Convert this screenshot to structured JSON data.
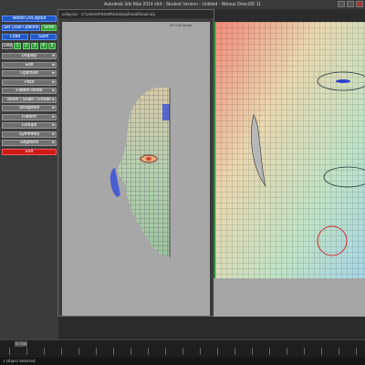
{
  "window": {
    "title": "Autodesk 3ds Max 2014 x64 - Student Version - Untitled - Nitrous Direct3D 11"
  },
  "left_panel": {
    "header": "About UVLayout",
    "top_buttons": {
      "set_load_options": "Set Load Options",
      "send": "Send",
      "load": "Load",
      "save": "Save"
    },
    "step_label": "Step",
    "step_numbers": [
      "1",
      "2",
      "3",
      "4",
      "5"
    ],
    "menu_items": [
      "Display",
      "Edit",
      "Optimize",
      "Pack",
      "Flatten Mode",
      "Move / Scale / Rotate",
      "Straighten",
      "Pattern",
      "Groups",
      "Symmetry",
      "Segment"
    ],
    "exit_label": "Exit",
    "colors": {
      "blue": "#1f58c8",
      "green": "#2e9e3a",
      "red": "#d01818",
      "gray": "#6f6f6f"
    }
  },
  "viewport_window": {
    "path": "uvlayout - C:\\Users\\PRO99\\Desktop\\head\\head.obj",
    "label": "3D Edit Mode"
  },
  "timeline": {
    "frame_label": "0 / 100",
    "ruler": [
      "0",
      "5",
      "10",
      "15",
      "20",
      "25",
      "30",
      "35",
      "40",
      "45",
      "50",
      "55",
      "60",
      "65",
      "70",
      "75",
      "80",
      "85",
      "90",
      "95",
      "100"
    ]
  },
  "status": {
    "text": "1 Object Selected"
  }
}
